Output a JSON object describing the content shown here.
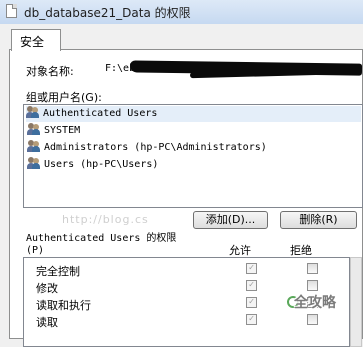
{
  "window": {
    "title": "db_database21_Data 的权限"
  },
  "tabs": [
    {
      "label": "安全"
    }
  ],
  "object": {
    "label": "对象名称:",
    "value": "F:\\eb"
  },
  "group": {
    "label": "组或用户名(G):",
    "users": [
      {
        "name": "Authenticated Users",
        "selected": true
      },
      {
        "name": "SYSTEM",
        "selected": false
      },
      {
        "name": "Administrators (hp-PC\\Administrators)",
        "selected": false
      },
      {
        "name": "Users (hp-PC\\Users)",
        "selected": false
      }
    ]
  },
  "watermark": {
    "text": "http://blog.cs"
  },
  "buttons": {
    "add": "添加(D)...",
    "remove": "删除(R)"
  },
  "permissions": {
    "title_line1": "Authenticated Users 的权限",
    "title_line2": "(P)",
    "allow_header": "允许",
    "deny_header": "拒绝",
    "rows": [
      {
        "name": "完全控制",
        "allow": true,
        "deny": false
      },
      {
        "name": "修改",
        "allow": true,
        "deny": false
      },
      {
        "name": "读取和执行",
        "allow": true,
        "deny": false
      },
      {
        "name": "读取",
        "allow": true,
        "deny": false
      }
    ]
  },
  "overlay": {
    "brand": "全攻略"
  },
  "colors": {
    "selection": "#e4eef9",
    "titlebar": "#c6d9f1"
  }
}
